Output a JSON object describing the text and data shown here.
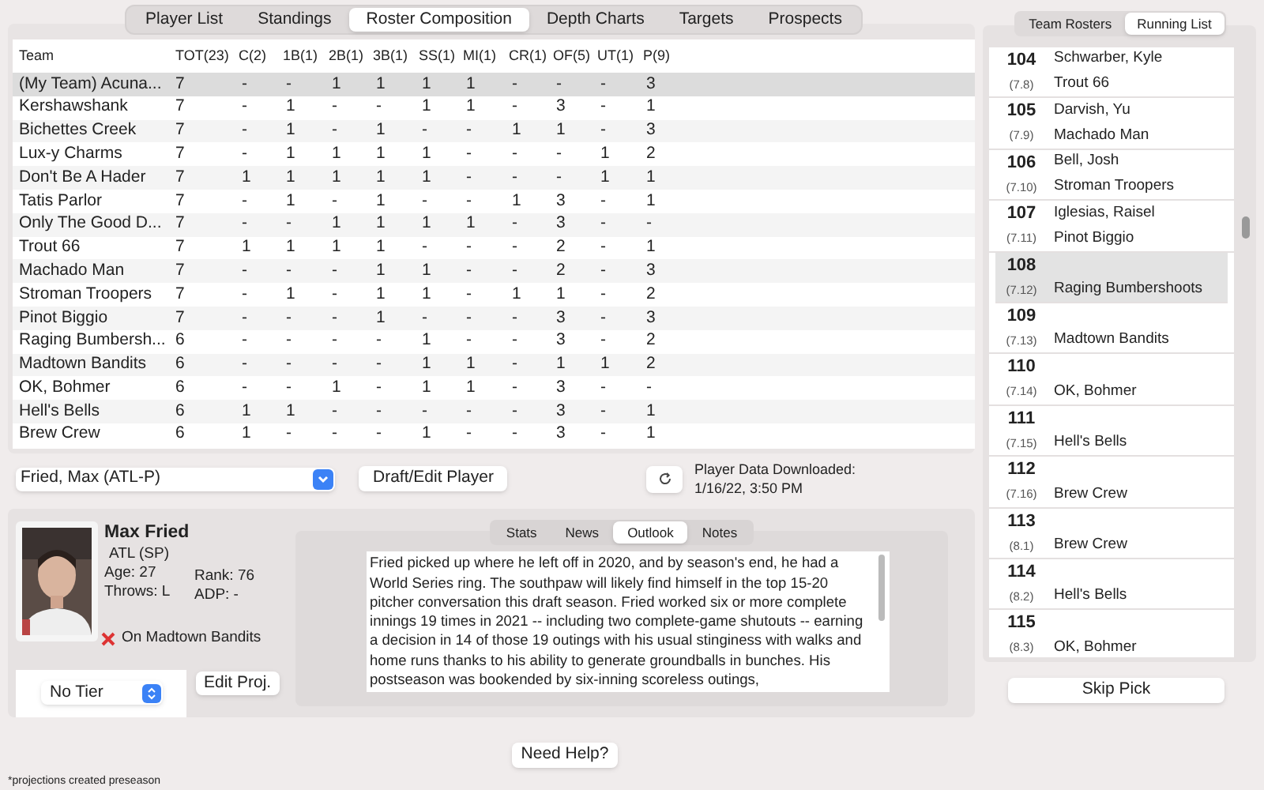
{
  "tabs": [
    {
      "label": "Player List",
      "selected": false
    },
    {
      "label": "Standings",
      "selected": false
    },
    {
      "label": "Roster Composition",
      "selected": true
    },
    {
      "label": "Depth Charts",
      "selected": false
    },
    {
      "label": "Targets",
      "selected": false
    },
    {
      "label": "Prospects",
      "selected": false
    }
  ],
  "table": {
    "columns": [
      "Team",
      "TOT(23)",
      "C(2)",
      "1B(1)",
      "2B(1)",
      "3B(1)",
      "SS(1)",
      "MI(1)",
      "CR(1)",
      "OF(5)",
      "UT(1)",
      "P(9)"
    ],
    "rows": [
      {
        "selected": true,
        "cells": [
          "(My Team) Acuna...",
          "7",
          "-",
          "-",
          "1",
          "1",
          "1",
          "1",
          "-",
          "-",
          "-",
          "3"
        ]
      },
      {
        "selected": false,
        "cells": [
          "Kershawshank",
          "7",
          "-",
          "1",
          "-",
          "-",
          "1",
          "1",
          "-",
          "3",
          "-",
          "1"
        ]
      },
      {
        "selected": false,
        "cells": [
          "Bichettes Creek",
          "7",
          "-",
          "1",
          "-",
          "1",
          "-",
          "-",
          "1",
          "1",
          "-",
          "3"
        ]
      },
      {
        "selected": false,
        "cells": [
          "Lux-y Charms",
          "7",
          "-",
          "1",
          "1",
          "1",
          "1",
          "-",
          "-",
          "-",
          "1",
          "2"
        ]
      },
      {
        "selected": false,
        "cells": [
          "Don't Be A Hader",
          "7",
          "1",
          "1",
          "1",
          "1",
          "1",
          "-",
          "-",
          "-",
          "1",
          "1"
        ]
      },
      {
        "selected": false,
        "cells": [
          "Tatis Parlor",
          "7",
          "-",
          "1",
          "-",
          "1",
          "-",
          "-",
          "1",
          "3",
          "-",
          "1"
        ]
      },
      {
        "selected": false,
        "cells": [
          "Only The Good D...",
          "7",
          "-",
          "-",
          "1",
          "1",
          "1",
          "1",
          "-",
          "3",
          "-",
          "-"
        ]
      },
      {
        "selected": false,
        "cells": [
          "Trout 66",
          "7",
          "1",
          "1",
          "1",
          "1",
          "-",
          "-",
          "-",
          "2",
          "-",
          "1"
        ]
      },
      {
        "selected": false,
        "cells": [
          "Machado Man",
          "7",
          "-",
          "-",
          "-",
          "1",
          "1",
          "-",
          "-",
          "2",
          "-",
          "3"
        ]
      },
      {
        "selected": false,
        "cells": [
          "Stroman Troopers",
          "7",
          "-",
          "1",
          "-",
          "1",
          "1",
          "-",
          "1",
          "1",
          "-",
          "2"
        ]
      },
      {
        "selected": false,
        "cells": [
          "Pinot Biggio",
          "7",
          "-",
          "-",
          "-",
          "1",
          "-",
          "-",
          "-",
          "3",
          "-",
          "3"
        ]
      },
      {
        "selected": false,
        "cells": [
          "Raging Bumbersh...",
          "6",
          "-",
          "-",
          "-",
          "-",
          "1",
          "-",
          "-",
          "3",
          "-",
          "2"
        ]
      },
      {
        "selected": false,
        "cells": [
          "Madtown Bandits",
          "6",
          "-",
          "-",
          "-",
          "-",
          "1",
          "1",
          "-",
          "1",
          "1",
          "2"
        ]
      },
      {
        "selected": false,
        "cells": [
          "OK, Bohmer",
          "6",
          "-",
          "-",
          "1",
          "-",
          "1",
          "1",
          "-",
          "3",
          "-",
          "-"
        ]
      },
      {
        "selected": false,
        "cells": [
          "Hell's Bells",
          "6",
          "1",
          "1",
          "-",
          "-",
          "-",
          "-",
          "-",
          "3",
          "-",
          "1"
        ]
      },
      {
        "selected": false,
        "cells": [
          "Brew Crew",
          "6",
          "1",
          "-",
          "-",
          "-",
          "1",
          "-",
          "-",
          "3",
          "-",
          "1"
        ]
      }
    ]
  },
  "player_select": {
    "value": "Fried, Max (ATL-P)"
  },
  "draft_button": "Draft/Edit Player",
  "download": {
    "label": "Player Data Downloaded:",
    "time": "1/16/22, 3:50 PM"
  },
  "player": {
    "name": "Max Fried",
    "team": "ATL (SP)",
    "age": "Age: 27",
    "throws": "Throws: L",
    "rank": "Rank: 76",
    "adp": "ADP: -",
    "status": "On Madtown Bandits",
    "tier": "No Tier",
    "edit_button": "Edit Proj."
  },
  "info_tabs": [
    {
      "label": "Stats",
      "selected": false
    },
    {
      "label": "News",
      "selected": false
    },
    {
      "label": "Outlook",
      "selected": true
    },
    {
      "label": "Notes",
      "selected": false
    }
  ],
  "outlook": "Fried picked up where he left off in 2020, and by season's end, he had a World Series ring. The southpaw will likely find himself in the top 15-20 pitcher conversation this draft season. Fried worked six or more complete innings 19 times in 2021 -- including two complete-game shutouts -- earning a decision in 14 of those 19 outings with his usual stinginess with walks and home runs thanks to his ability to generate groundballs in bunches. His postseason was bookended by six-inning scoreless outings,",
  "help_button": "Need Help?",
  "footnote": "*projections created preseason",
  "side_tabs": [
    {
      "label": "Team Rosters",
      "selected": false
    },
    {
      "label": "Running List",
      "selected": true
    }
  ],
  "picks": [
    {
      "number": "104",
      "round": "(7.8)",
      "player": "Schwarber, Kyle",
      "team": "Trout 66",
      "selected": false
    },
    {
      "number": "105",
      "round": "(7.9)",
      "player": "Darvish, Yu",
      "team": "Machado Man",
      "selected": false
    },
    {
      "number": "106",
      "round": "(7.10)",
      "player": "Bell, Josh",
      "team": "Stroman Troopers",
      "selected": false
    },
    {
      "number": "107",
      "round": "(7.11)",
      "player": "Iglesias, Raisel",
      "team": "Pinot Biggio",
      "selected": false
    },
    {
      "number": "108",
      "round": "(7.12)",
      "team": "Raging Bumbershoots",
      "selected": true
    },
    {
      "number": "109",
      "round": "(7.13)",
      "team": "Madtown Bandits",
      "selected": false
    },
    {
      "number": "110",
      "round": "(7.14)",
      "team": "OK, Bohmer",
      "selected": false
    },
    {
      "number": "111",
      "round": "(7.15)",
      "team": "Hell's Bells",
      "selected": false
    },
    {
      "number": "112",
      "round": "(7.16)",
      "team": "Brew Crew",
      "selected": false
    },
    {
      "number": "113",
      "round": "(8.1)",
      "team": "Brew Crew",
      "selected": false
    },
    {
      "number": "114",
      "round": "(8.2)",
      "team": "Hell's Bells",
      "selected": false
    },
    {
      "number": "115",
      "round": "(8.3)",
      "team": "OK, Bohmer",
      "selected": false
    }
  ],
  "skip_button": "Skip Pick"
}
